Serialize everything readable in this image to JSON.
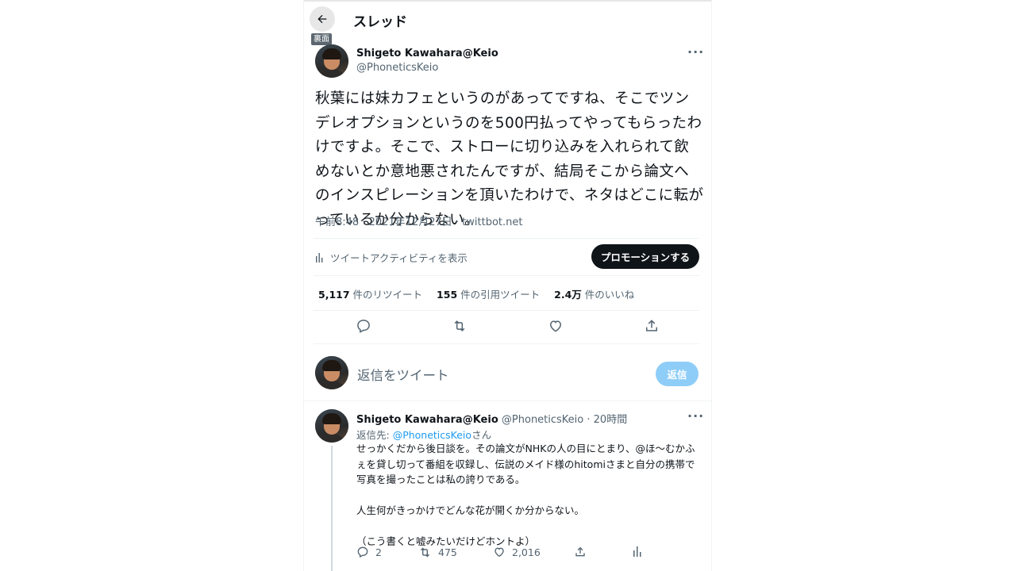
{
  "header": {
    "title": "スレッド",
    "back_tooltip": "裏面"
  },
  "tweet": {
    "author_name": "Shigeto Kawahara@Keio",
    "author_handle": "@PhoneticsKeio",
    "text": "秋葉には妹カフェというのがあってですね、そこでツンデレオプションというのを500円払ってやってもらったわけですよ。そこで、ストローに切り込みを入れられて飲めないとか意地悪されたんですが、結局そこから論文へのインスピレーションを頂いたわけで、ネタはどこに転がっているか分からない。",
    "meta": "午前8:48 · 2021年12月27日 · twittbot.net",
    "activity_label": "ツイートアクティビティを表示",
    "promote_label": "プロモーションする",
    "stats": {
      "retweets_count": "5,117",
      "retweets_label": "件のリツイート",
      "quotes_count": "155",
      "quotes_label": "件の引用ツイート",
      "likes_count": "2.4万",
      "likes_label": "件のいいね"
    }
  },
  "composer": {
    "placeholder": "返信をツイート",
    "reply_button": "返信"
  },
  "reply": {
    "author_name": "Shigeto Kawahara@Keio",
    "author_handle": "@PhoneticsKeio",
    "time": "· 20時間",
    "reply_to_prefix": "返信先: ",
    "reply_to_handle": "@PhoneticsKeio",
    "reply_to_suffix": "さん",
    "text": "せっかくだから後日談を。その論文がNHKの人の目にとまり、@ほ〜むかふぇを貸し切って番組を収録し、伝説のメイド様のhitomiさまと自分の携帯で写真を撮ったことは私の誇りである。\n\n人生何がきっかけでどんな花が開くか分からない。\n\n（こう書くと嘘みたいだけどホントよ）",
    "reply_count": "2",
    "retweet_count": "475",
    "like_count": "2,016"
  },
  "icons": [
    "back-arrow-icon",
    "more-icon",
    "bar-chart-icon",
    "reply-icon",
    "retweet-icon",
    "like-icon",
    "share-icon"
  ]
}
